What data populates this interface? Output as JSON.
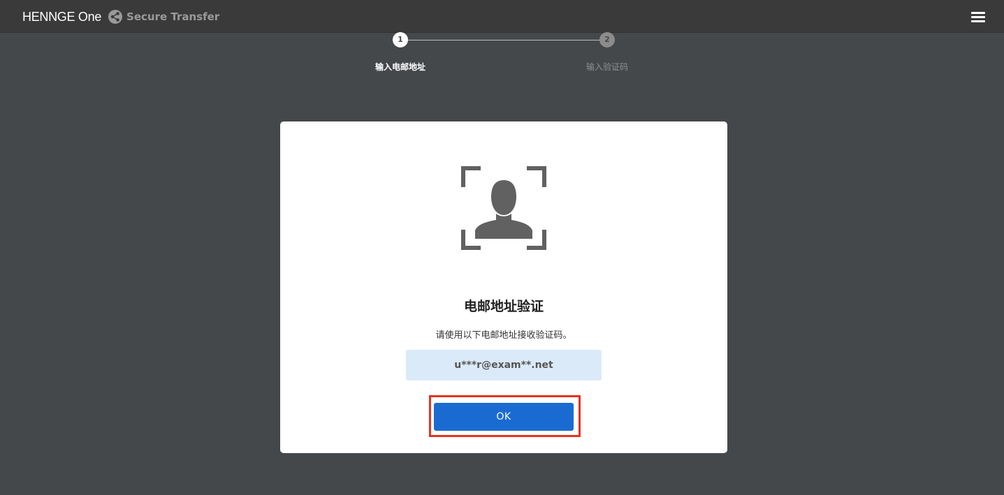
{
  "header": {
    "logo_text": "HENNGE One",
    "product_name": "Secure Transfer",
    "logo_icon": "share-icon",
    "menu_icon": "hamburger-menu-icon"
  },
  "stepper": {
    "steps": [
      {
        "number": "1",
        "label": "输入电邮地址",
        "state": "active"
      },
      {
        "number": "2",
        "label": "输入验证码",
        "state": "inactive"
      }
    ]
  },
  "dialog": {
    "icon": "face-recognition-icon",
    "title": "电邮地址验证",
    "description": "请使用以下电邮地址接收验证码。",
    "email": "u***r@exam**.net",
    "ok_label": "OK"
  },
  "colors": {
    "background": "#45484b",
    "header": "#3a3a3a",
    "button": "#1a6bd1",
    "email_box": "#dbeaf9",
    "highlight": "#e8321c"
  }
}
